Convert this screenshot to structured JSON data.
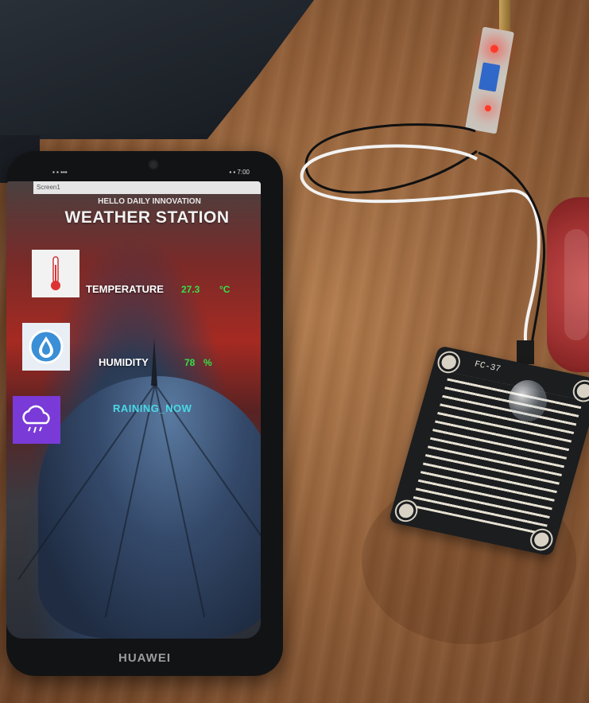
{
  "phone": {
    "brand": "HUAWEI",
    "status_left": "▪ ▪ ▪▪▪",
    "status_right": "▪ ▪ 7:00"
  },
  "app": {
    "window_label": "Screen1",
    "subtitle": "HELLO DAILY INNOVATION",
    "title": "WEATHER STATION",
    "temperature": {
      "label": "TEMPERATURE",
      "value": "27.3",
      "unit": "°C"
    },
    "humidity": {
      "label": "HUMIDITY",
      "value": "78",
      "unit": "%"
    },
    "rain": {
      "status": "RAINING_NOW"
    },
    "icons": {
      "temperature": "thermometer-icon",
      "humidity": "water-drop-icon",
      "rain": "rain-cloud-icon"
    }
  },
  "scene": {
    "sensor_label": "FC-37"
  }
}
